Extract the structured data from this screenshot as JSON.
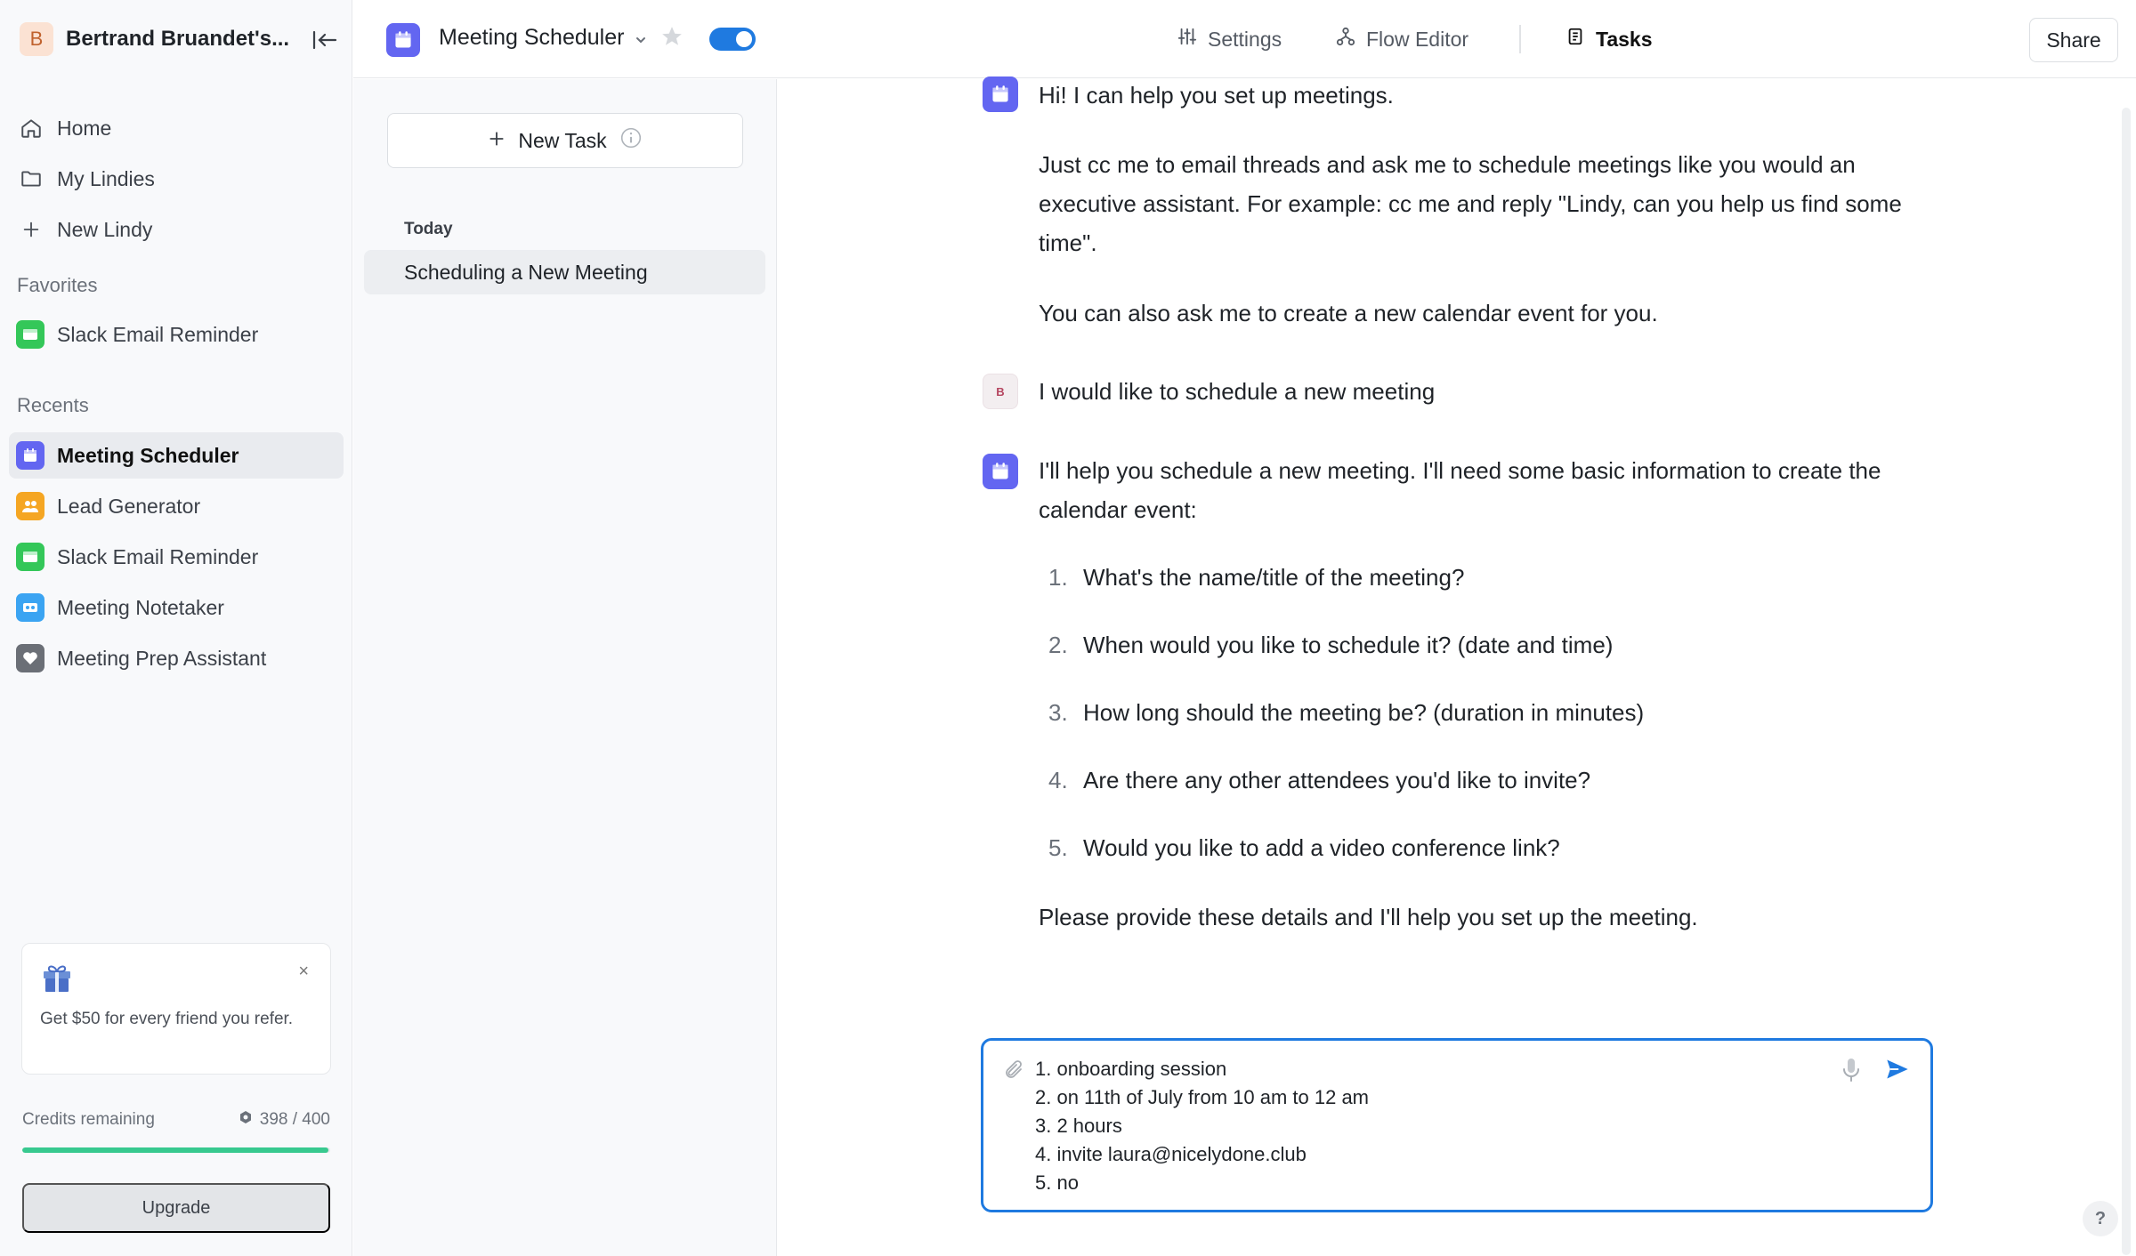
{
  "workspace": {
    "avatar_letter": "B",
    "name": "Bertrand Bruandet's..."
  },
  "sidebar": {
    "nav": [
      {
        "label": "Home",
        "icon": "home-icon"
      },
      {
        "label": "My Lindies",
        "icon": "folder-icon"
      },
      {
        "label": "New Lindy",
        "icon": "plus-icon"
      }
    ],
    "favorites_label": "Favorites",
    "favorites": [
      {
        "label": "Slack Email Reminder",
        "color": "#34c759"
      }
    ],
    "recents_label": "Recents",
    "recents": [
      {
        "label": "Meeting Scheduler",
        "color": "#6366f1",
        "active": true
      },
      {
        "label": "Lead Generator",
        "color": "#f5a623"
      },
      {
        "label": "Slack Email Reminder",
        "color": "#34c759"
      },
      {
        "label": "Meeting Notetaker",
        "color": "#3ba4f2"
      },
      {
        "label": "Meeting Prep Assistant",
        "color": "#6b6f76"
      }
    ],
    "referral": {
      "text": "Get $50 for every friend you refer.",
      "close": "×"
    },
    "credits": {
      "label": "Credits remaining",
      "count": "398 / 400",
      "fraction": 0.995
    },
    "upgrade_label": "Upgrade"
  },
  "topbar": {
    "agent_name": "Meeting Scheduler",
    "enabled": true,
    "tabs": [
      {
        "label": "Settings",
        "icon": "sliders-icon"
      },
      {
        "label": "Flow Editor",
        "icon": "flow-icon"
      },
      {
        "label": "Tasks",
        "icon": "document-icon",
        "active": true
      }
    ],
    "share_label": "Share"
  },
  "tasks": {
    "new_task_label": "New Task",
    "section_label": "Today",
    "items": [
      {
        "label": "Scheduling a New Meeting"
      }
    ]
  },
  "chat": {
    "bot_greeting": {
      "p1": "Hi! I can help you set up meetings.",
      "p2": "Just cc me to email threads and ask me to schedule meetings like you would an executive assistant. For example: cc me and reply \"Lindy, can you help us find some time\".",
      "p3": "You can also ask me to create a new calendar event for you."
    },
    "user_message": {
      "avatar_letter": "B",
      "text": "I would like to schedule a new meeting"
    },
    "bot_reply": {
      "intro": "I'll help you schedule a new meeting. I'll need some basic information to create the calendar event:",
      "questions": [
        {
          "num": "1.",
          "text": "What's the name/title of the meeting?"
        },
        {
          "num": "2.",
          "text": "When would you like to schedule it? (date and time)"
        },
        {
          "num": "3.",
          "text": "How long should the meeting be? (duration in minutes)"
        },
        {
          "num": "4.",
          "text": "Are there any other attendees you'd like to invite?"
        },
        {
          "num": "5.",
          "text": "Would you like to add a video conference link?"
        }
      ],
      "outro": "Please provide these details and I'll help you set up the meeting."
    },
    "composer_value": "1. onboarding session\n2. on 11th of July from 10 am to 12 am\n3. 2 hours\n4. invite laura@nicelydone.club\n5. no"
  },
  "help_label": "?"
}
